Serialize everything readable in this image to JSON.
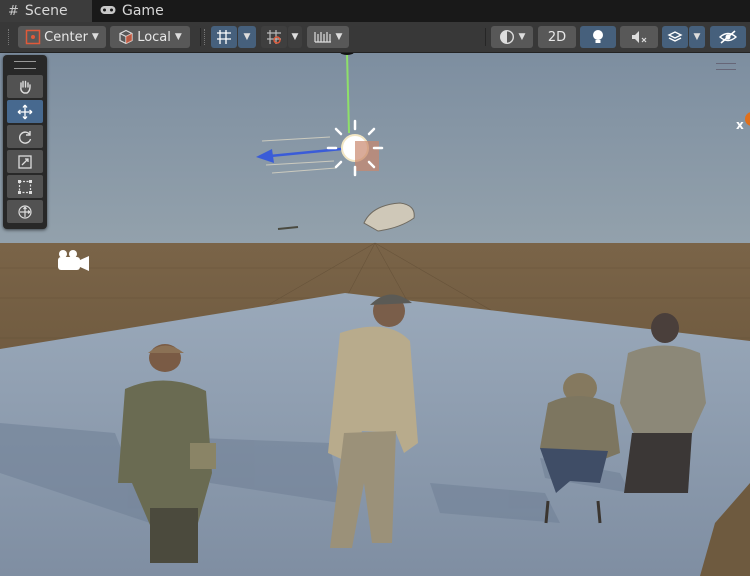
{
  "tabs": [
    {
      "label": "Scene",
      "icon": "grid-hash-icon"
    },
    {
      "label": "Game",
      "icon": "gamepad-icon"
    }
  ],
  "toolbar": {
    "pivot_label": "Center",
    "space_label": "Local",
    "mode_2d_label": "2D"
  },
  "gizmo": {
    "axis_label": "x"
  },
  "colors": {
    "active_blue": "#46607c",
    "toolbar_bg": "#383838",
    "floor": "#8e9db0",
    "ground": "#6a5438"
  }
}
